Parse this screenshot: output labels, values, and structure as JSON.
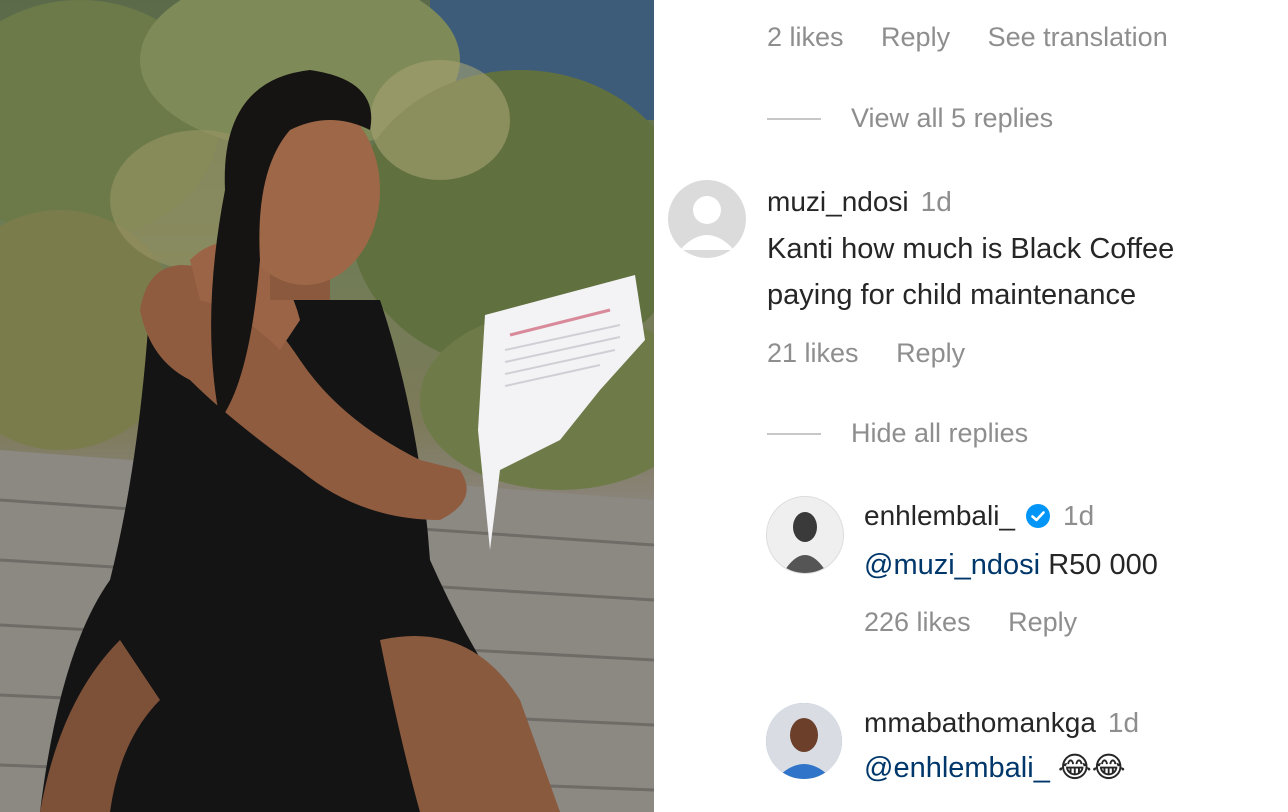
{
  "comments": {
    "c0": {
      "likes": "2 likes",
      "reply": "Reply",
      "translate": "See translation"
    },
    "c0_thread": {
      "label": "View all 5 replies"
    },
    "c1": {
      "username": "muzi_ndosi",
      "time": "1d",
      "text_line1": "Kanti how much is Black Coffee",
      "text_line2": "paying for child maintenance",
      "likes": "21 likes",
      "reply": "Reply"
    },
    "c1_thread": {
      "label": "Hide all replies"
    },
    "r1": {
      "username": "enhlembali_",
      "time": "1d",
      "mention": "@muzi_ndosi",
      "text": "R50 000",
      "likes": "226 likes",
      "reply": "Reply"
    },
    "r2": {
      "username": "mmabathomankga",
      "time": "1d",
      "mention": "@enhlembali_",
      "text": "😂😂"
    }
  },
  "icons": {
    "verified": "verified-badge-icon",
    "avatar_placeholder": "default-avatar-icon"
  },
  "colors": {
    "mention": "#00376b",
    "muted": "#8e8e8e",
    "verified": "#0095f6"
  }
}
